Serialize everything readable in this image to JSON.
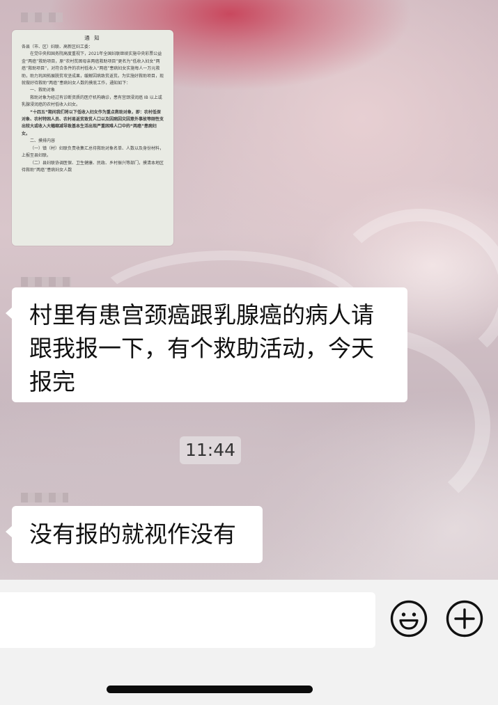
{
  "chat": {
    "document_thumbnail": {
      "title": "通  知",
      "paragraphs": [
        "各县（市、区）妇联、高新区妇工委：",
        "在党中央和国务院高度重视下，2021年全国妇联继续实施中央彩票公益金“两癌”救助项目，原“农村贫困母亲两癌救助项目”更名为“低收入妇女“两癌”救助项目”，对符合条件的农村低收入“两癌”患病妇女实施每人一万元救助，助力巩固拓展脱贫攻坚成果，缓解因病致贫返贫。为实施好救助项目，现就做好待救助“两癌”患病妇女人数的摸底工作，通知如下：",
        "一、救助对象",
        "救助对象为经过有诊断资质的医疗机构确诊，患有宫颈浸润癌 IB 以上或乳腺浸润癌的农村低收入妇女。",
        "“十四五”期间我们将以下低收入妇女作为重点救助对象，即：农村低保对象、农村特困人员、农村易返贫致贫人口以及因病因灾因意外事故等刚性支出较大或收入大幅缩减导致基本生活出现严重困难人口中的“两癌”患病妇女。",
        "二、摸排内容",
        "（一）镇（村）妇联负责收集汇总待救助对象名单、人数以及身份材料，上报至县妇联。",
        "（二）县妇联协调医保、卫生健康、民政、乡村振兴等部门，摸清本地区待救助“两癌”患病妇女人数"
      ]
    },
    "messages": [
      {
        "text": "村里有患宫颈癌跟乳腺癌的病人请跟我报一下，有个救助活动，今天报完"
      },
      {
        "text": "没有报的就视作没有"
      }
    ],
    "timestamp": "11:44"
  },
  "input_bar": {
    "value": "",
    "placeholder": "",
    "emoji_icon": "emoji-icon",
    "plus_icon": "plus-icon"
  }
}
